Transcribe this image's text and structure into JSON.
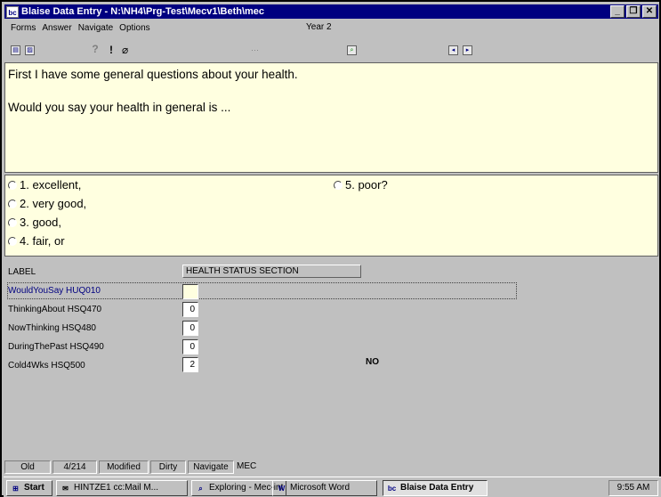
{
  "window": {
    "title": "Blaise Data Entry - N:\\NH4\\Prg-Test\\Mecv1\\Beth\\mec",
    "app_icon": "bc"
  },
  "menu": {
    "items": [
      "Forms",
      "Answer",
      "Navigate",
      "Options"
    ],
    "year": "Year 2"
  },
  "toolbar": {
    "dots": "···",
    "icons": [
      "copy-icon",
      "picture-icon",
      "help-icon",
      "remark-icon",
      "attach-icon",
      "find-icon",
      "prev-picture-icon",
      "next-picture-icon"
    ]
  },
  "question": {
    "line1": "First I have some general questions about your health.",
    "line2": "Would you say your health in general is ..."
  },
  "answers": {
    "opt1": "1.  excellent,",
    "opt2": "2.  very good,",
    "opt3": "3.  good,",
    "opt4": "4.  fair, or",
    "opt5": "5.  poor?"
  },
  "fields": {
    "label_header": "LABEL",
    "section_header": "HEALTH STATUS SECTION",
    "rows": [
      {
        "label": "WouldYouSay HUQ010",
        "value": ""
      },
      {
        "label": "ThinkingAbout HSQ470",
        "value": "0"
      },
      {
        "label": "NowThinking HSQ480",
        "value": "0"
      },
      {
        "label": "DuringThePast HSQ490",
        "value": "0"
      },
      {
        "label": "Cold4Wks HSQ500",
        "value": "2"
      }
    ],
    "answer_text": "NO"
  },
  "status": {
    "state": "Old",
    "position": "4/214",
    "modified": "Modified",
    "dirty": "Dirty",
    "mode": "Navigate",
    "module": "MEC"
  },
  "taskbar": {
    "start": "Start",
    "items": [
      "HINTZE1 cc:Mail M...",
      "Exploring - Mec-int",
      "Microsoft Word",
      "Blaise Data Entry"
    ],
    "clock": "9:55 AM"
  },
  "colors": {
    "title_bar": "#000080",
    "pane_background": "#ffffe0",
    "chrome": "#c0c0c0",
    "focused_label": "#000080"
  }
}
